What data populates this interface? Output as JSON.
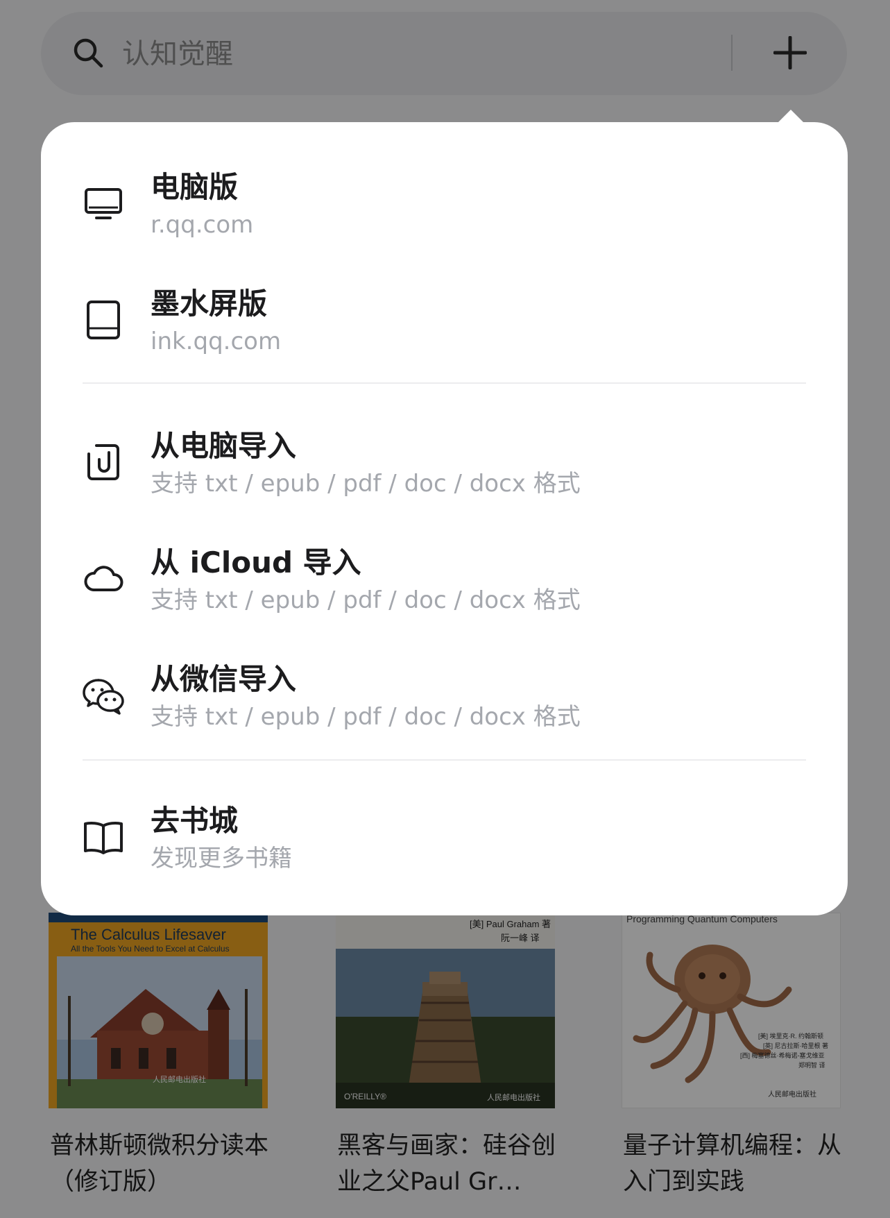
{
  "search": {
    "placeholder": "认知觉醒"
  },
  "menu": {
    "items": [
      {
        "title": "电脑版",
        "subtitle": "r.qq.com",
        "icon": "monitor-icon"
      },
      {
        "title": "墨水屏版",
        "subtitle": "ink.qq.com",
        "icon": "tablet-icon"
      },
      {
        "title": "从电脑导入",
        "subtitle": "支持 txt / epub / pdf / doc / docx 格式",
        "icon": "file-import-icon"
      },
      {
        "title": "从 iCloud 导入",
        "subtitle": "支持 txt / epub / pdf / doc / docx 格式",
        "icon": "cloud-icon"
      },
      {
        "title": "从微信导入",
        "subtitle": "支持 txt / epub / pdf / doc / docx 格式",
        "icon": "wechat-icon"
      },
      {
        "title": "去书城",
        "subtitle": "发现更多书籍",
        "icon": "book-open-icon"
      }
    ]
  },
  "books": [
    {
      "title": "普林斯顿微积分读本（修订版）",
      "cover": {
        "line1": "The Calculus Lifesaver",
        "line2": "All the Tools You Need to Excel at Calculus",
        "publisher": "人民邮电出版社"
      }
    },
    {
      "title": "黑客与画家：硅谷创业之父Paul Gr…",
      "cover": {
        "author": "[美] Paul Graham 著",
        "translator": "阮一峰 译",
        "publisher_left": "O'REILLY®",
        "publisher_right": "人民邮电出版社"
      }
    },
    {
      "title": "量子计算机编程：从入门到实践",
      "cover": {
        "top": "Programming Quantum Computers",
        "author1": "[美] 埃里克·R. 约翰斯顿",
        "author2": "[英] 尼古拉斯·哈里根 著",
        "author3": "[西] 梅塞德丝·希梅诺-塞戈维亚",
        "translator": "郑明智 译",
        "publisher": "人民邮电出版社"
      }
    }
  ],
  "colors": {
    "popover_bg": "#ffffff",
    "title_text": "#1c1c1e",
    "subtitle_text": "#a4a7ad",
    "overlay": "rgba(0,0,0,0.43)"
  }
}
